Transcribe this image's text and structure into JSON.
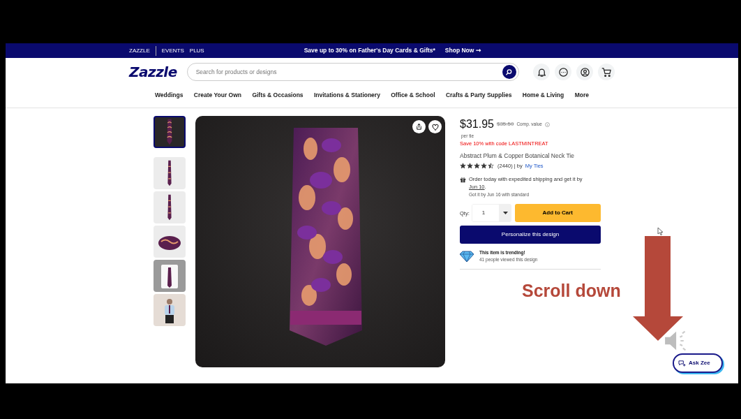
{
  "top_bar": {
    "links": [
      "ZAZZLE",
      "EVENTS",
      "PLUS"
    ],
    "promo": "Save up to 30% on Father's Day Cards & Gifts*",
    "promo_link": "Shop Now ➞"
  },
  "header": {
    "logo": "Zazzle",
    "search": {
      "placeholder": "Search for products or designs"
    }
  },
  "nav": [
    "Weddings",
    "Create Your Own",
    "Gifts & Occasions",
    "Invitations & Stationery",
    "Office & School",
    "Crafts & Party Supplies",
    "Home & Living",
    "More"
  ],
  "thumbnails": [
    {
      "kind": "flat",
      "selected": true
    },
    {
      "kind": "hanging",
      "selected": false
    },
    {
      "kind": "hanging",
      "selected": false
    },
    {
      "kind": "rolled",
      "selected": false
    },
    {
      "kind": "shirt",
      "selected": false
    },
    {
      "kind": "person",
      "selected": false
    }
  ],
  "product": {
    "price": "$31.95",
    "comp_price": "$35.50",
    "comp_label": "Comp. value",
    "unit": "per tie",
    "promo": "Save 10% with code LASTMINTREAT",
    "title": "Abstract Plum & Copper Botanical Neck Tie",
    "stars": 4.5,
    "review_count": "(2440) | by",
    "seller": "My Ties",
    "shipping": {
      "text": "Order today with expedited shipping and get it by",
      "date": "Jun 10",
      "after": ".",
      "standard": "Got it by Jun 16 with standard"
    },
    "qty_label": "Qty:",
    "qty": "1",
    "add_to_cart": "Add to Cart",
    "personalize": "Personalize this design",
    "trending": {
      "title": "This item is trending!",
      "subtitle": "41 people viewed this design"
    }
  },
  "ask_zee": "Ask Zee",
  "annotation": {
    "text": "Scroll down"
  }
}
